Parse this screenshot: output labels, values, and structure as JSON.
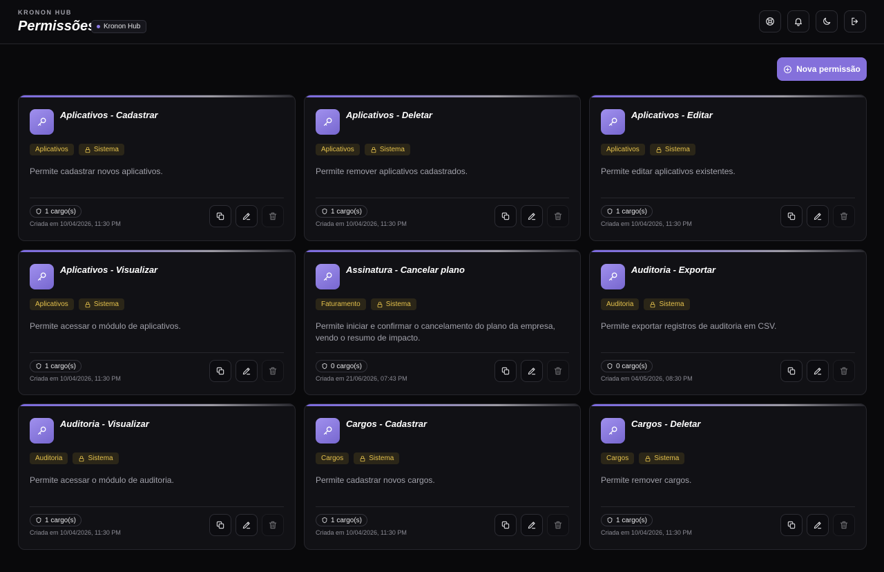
{
  "header": {
    "brand": "KRONON HUB",
    "title": "Permissões",
    "badge": "Kronon Hub",
    "actions": [
      {
        "name": "support-button",
        "icon": "lifebuoy-icon"
      },
      {
        "name": "notifications-button",
        "icon": "bell-icon"
      },
      {
        "name": "theme-toggle-button",
        "icon": "moon-icon"
      },
      {
        "name": "logout-button",
        "icon": "logout-icon"
      }
    ]
  },
  "toolbar": {
    "new_label": "Nova permissão"
  },
  "colors": {
    "accent": "#8470db",
    "tag_text": "#e3c04c",
    "background": "#09090b"
  },
  "card_actions": [
    {
      "name": "duplicate-button",
      "icon": "copy-icon"
    },
    {
      "name": "edit-button",
      "icon": "pencil-icon"
    },
    {
      "name": "delete-button",
      "icon": "trash-icon",
      "disabled": true
    }
  ],
  "permissions": [
    {
      "title": "Aplicativos - Cadastrar",
      "module": "Aplicativos",
      "system_tag": "Sistema",
      "description": "Permite cadastrar novos aplicativos.",
      "roles": "1 cargo(s)",
      "created": "Criada em 10/04/2026, 11:30 PM"
    },
    {
      "title": "Aplicativos - Deletar",
      "module": "Aplicativos",
      "system_tag": "Sistema",
      "description": "Permite remover aplicativos cadastrados.",
      "roles": "1 cargo(s)",
      "created": "Criada em 10/04/2026, 11:30 PM"
    },
    {
      "title": "Aplicativos - Editar",
      "module": "Aplicativos",
      "system_tag": "Sistema",
      "description": "Permite editar aplicativos existentes.",
      "roles": "1 cargo(s)",
      "created": "Criada em 10/04/2026, 11:30 PM"
    },
    {
      "title": "Aplicativos - Visualizar",
      "module": "Aplicativos",
      "system_tag": "Sistema",
      "description": "Permite acessar o módulo de aplicativos.",
      "roles": "1 cargo(s)",
      "created": "Criada em 10/04/2026, 11:30 PM"
    },
    {
      "title": "Assinatura - Cancelar plano",
      "module": "Faturamento",
      "system_tag": "Sistema",
      "description": "Permite iniciar e confirmar o cancelamento do plano da empresa, vendo o resumo de impacto.",
      "roles": "0 cargo(s)",
      "created": "Criada em 21/06/2026, 07:43 PM"
    },
    {
      "title": "Auditoria - Exportar",
      "module": "Auditoria",
      "system_tag": "Sistema",
      "description": "Permite exportar registros de auditoria em CSV.",
      "roles": "0 cargo(s)",
      "created": "Criada em 04/05/2026, 08:30 PM"
    },
    {
      "title": "Auditoria - Visualizar",
      "module": "Auditoria",
      "system_tag": "Sistema",
      "description": "Permite acessar o módulo de auditoria.",
      "roles": "1 cargo(s)",
      "created": "Criada em 10/04/2026, 11:30 PM"
    },
    {
      "title": "Cargos - Cadastrar",
      "module": "Cargos",
      "system_tag": "Sistema",
      "description": "Permite cadastrar novos cargos.",
      "roles": "1 cargo(s)",
      "created": "Criada em 10/04/2026, 11:30 PM"
    },
    {
      "title": "Cargos - Deletar",
      "module": "Cargos",
      "system_tag": "Sistema",
      "description": "Permite remover cargos.",
      "roles": "1 cargo(s)",
      "created": "Criada em 10/04/2026, 11:30 PM"
    }
  ]
}
